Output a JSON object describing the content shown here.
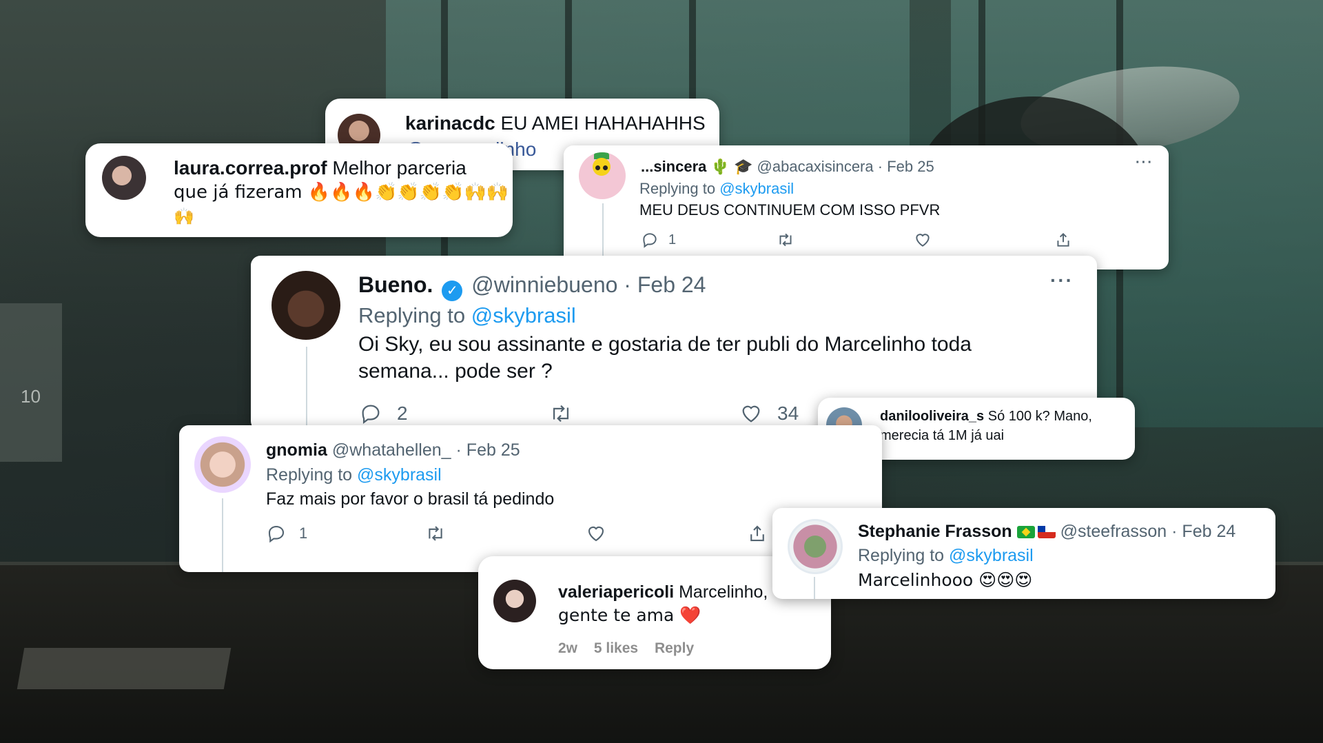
{
  "karina": {
    "username": "karinacdc",
    "text": "EU AMEI HAHAHAHHS",
    "text2": "@walt...marcelinho",
    "partial": "@xxxx ...elinho"
  },
  "laura": {
    "username": "laura.correa.prof",
    "text": "Melhor parceria",
    "text2": "que já fizeram 🔥🔥🔥👏👏👏👏🙌🙌",
    "text3": "🙌"
  },
  "abacaxi": {
    "name": "...sincera 🌵 🎓",
    "handle": "@abacaxisincera",
    "date": "· Feb 25",
    "replying_label": "Replying to",
    "replying_to": "@skybrasil",
    "text": "MEU DEUS CONTINUEM COM ISSO PFVR",
    "reply_count": "1",
    "more": "···"
  },
  "bueno": {
    "name": "Bueno.",
    "verified": "✓",
    "handle": "@winniebueno",
    "date": "· Feb 24",
    "replying_label": "Replying to",
    "replying_to": "@skybrasil",
    "text1": "Oi Sky, eu sou assinante e gostaria de ter publi do Marcelinho toda",
    "text2": "semana... pode ser ?",
    "reply_count": "2",
    "like_count": "34",
    "more": "···"
  },
  "gnomia": {
    "name": "gnomia",
    "handle": "@whatahellen_",
    "date": "· Feb 25",
    "replying_label": "Replying to",
    "replying_to": "@skybrasil",
    "text": "Faz mais por favor o brasil tá pedindo",
    "reply_count": "1"
  },
  "danilo": {
    "username": "danilooliveira_s",
    "text": "Só 100 k? Mano,",
    "text2": "merecia tá 1M já uai"
  },
  "stephanie": {
    "name": "Stephanie Frasson",
    "handle": "@steefrasson",
    "date": "· Feb 24",
    "replying_label": "Replying to",
    "replying_to": "@skybrasil",
    "text": "Marcelinhooo 😍😍😍"
  },
  "valeria": {
    "username": "valeriapericoli",
    "text": "Marcelinho,",
    "text2": "gente te ama ❤️",
    "time": "2w",
    "likes": "5 likes",
    "reply": "Reply"
  }
}
